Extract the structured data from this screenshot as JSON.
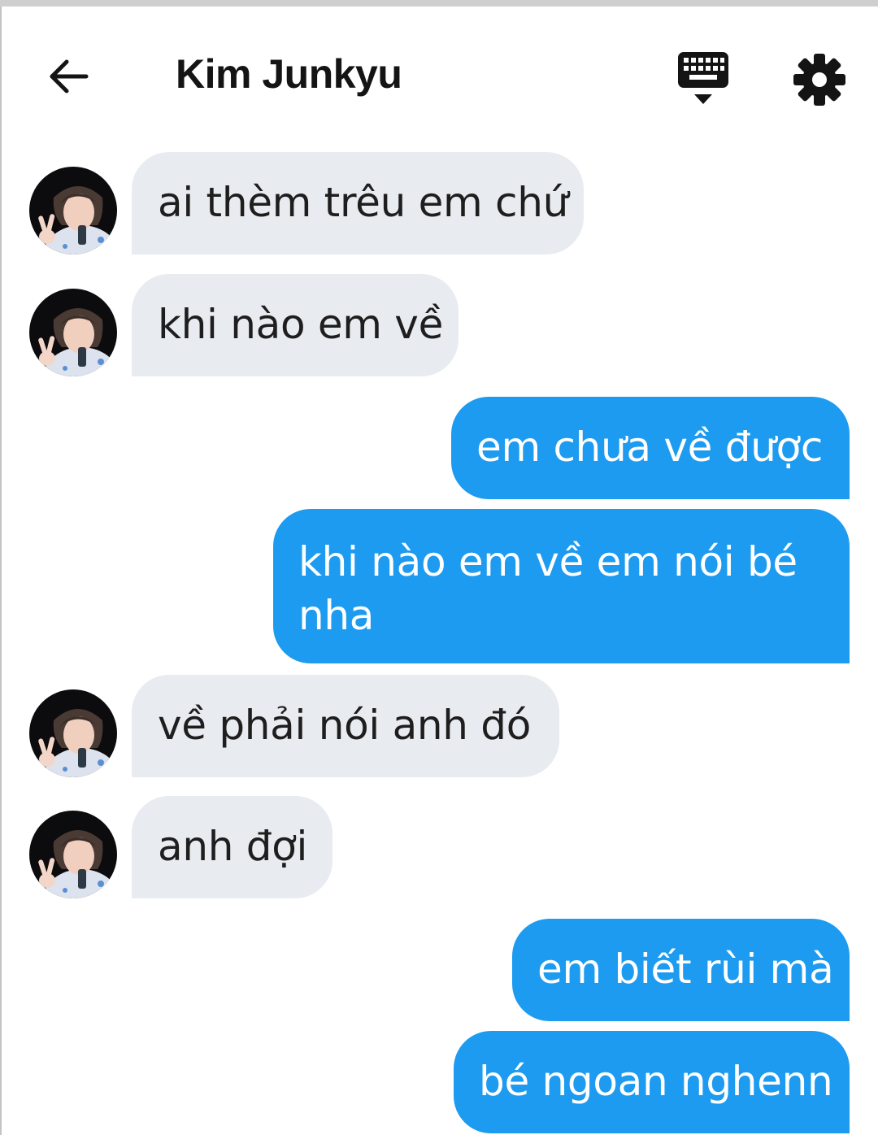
{
  "header": {
    "title": "Kim Junkyu",
    "back_icon": "arrow-left-icon",
    "keyboard_icon": "keyboard-hide-icon",
    "settings_icon": "gear-icon"
  },
  "colors": {
    "incoming_bubble": "#e8ebef",
    "outgoing_bubble": "#1d9bf0",
    "text_dark": "#1e1e1e",
    "text_light": "#ffffff"
  },
  "messages": [
    {
      "direction": "incoming",
      "text": "ai thèm trêu em chứ"
    },
    {
      "direction": "incoming",
      "text": "khi nào em về"
    },
    {
      "direction": "outgoing",
      "text": "em chưa về được"
    },
    {
      "direction": "outgoing",
      "text": "khi nào em về em nói bé nha"
    },
    {
      "direction": "incoming",
      "text": "về phải nói anh đó"
    },
    {
      "direction": "incoming",
      "text": "anh đợi"
    },
    {
      "direction": "outgoing",
      "text": "em biết rùi mà"
    },
    {
      "direction": "outgoing",
      "text": "bé ngoan nghenn"
    }
  ]
}
